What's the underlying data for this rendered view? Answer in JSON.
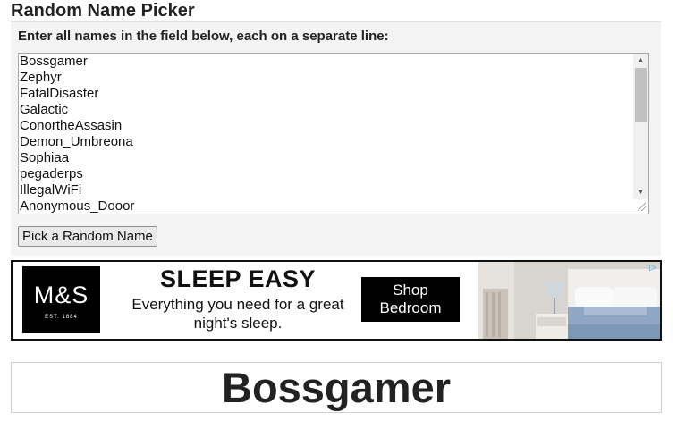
{
  "page": {
    "title": "Random Name Picker"
  },
  "picker": {
    "instructions": "Enter all names in the field below, each on a separate line:",
    "names": [
      "Bossgamer",
      "Zephyr",
      "FatalDisaster",
      "Galactic",
      "ConortheAssasin",
      "Demon_Umbreona",
      "Sophiaa",
      "pegaderps",
      "IllegalWiFi",
      "Anonymous_Dooor"
    ],
    "pick_button_label": "Pick a Random Name"
  },
  "ad": {
    "logo_text": "M&S",
    "logo_est": "EST. 1884",
    "headline": "SLEEP EASY",
    "subline": "Everything you need for a great night's sleep.",
    "cta": "Shop Bedroom",
    "choices_icon": "ad-choices-icon"
  },
  "result": {
    "name": "Bossgamer"
  },
  "colors": {
    "panel_bg": "#f3f3f3",
    "ad_black": "#000000",
    "adchoices_blue": "#3aa0d8"
  }
}
